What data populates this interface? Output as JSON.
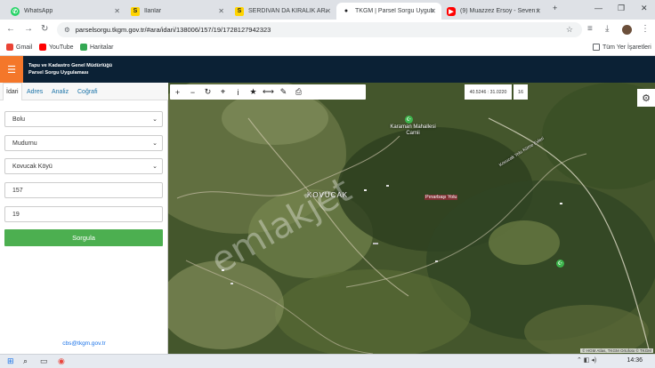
{
  "browser": {
    "tabs": [
      {
        "title": "WhatsApp",
        "icon": "whatsapp-icon",
        "color": "#25d366"
      },
      {
        "title": "İlanlar",
        "icon": "sahibinden-icon",
        "color": "#ffd400"
      },
      {
        "title": "SERDİVAN DA KİRALIK ARAZİ",
        "icon": "sahibinden-icon",
        "color": "#ffd400"
      },
      {
        "title": "TKGM | Parsel Sorgu Uygulama",
        "icon": "map-pin-icon",
        "color": "#202124"
      },
      {
        "title": "(9) Muazzez Ersoy - Seven Gö",
        "icon": "youtube-icon",
        "color": "#ff0000"
      }
    ],
    "url": "parselsorgu.tkgm.gov.tr/#ara/idari/138006/157/19/1728127942323",
    "bookmarks": [
      "Gmail",
      "YouTube",
      "Haritalar"
    ],
    "all_bookmarks": "Tüm Yer İşaretleri"
  },
  "app": {
    "title_line1": "Tapu ve Kadastro Genel Müdürlüğü",
    "title_line2": "Parsel Sorgu Uygulaması"
  },
  "sidebar": {
    "tabs": [
      "İdari",
      "Adres",
      "Analiz",
      "Coğrafi"
    ],
    "il": "Bolu",
    "ilce": "Mudurnu",
    "mahalle": "Kovucak Köyü",
    "ada": "157",
    "parsel": "19",
    "query_button": "Sorgula",
    "email": "cbs@tkgm.gov.tr"
  },
  "map": {
    "coordinates": "40.5246 : 31.0220",
    "zoom": "16",
    "labels": {
      "village": "KOVUCAK",
      "mosque": "Karaman Mahallesi Camii",
      "road": "Kovucak Yolu Küme Evleri",
      "small_road": "Pınarbaşı Yolu",
      "watermark": "emlakjet"
    },
    "attribution": "© HGM Atlas, TKGM Ortofoto © TKGM"
  },
  "taskbar": {
    "time": "14:36"
  }
}
